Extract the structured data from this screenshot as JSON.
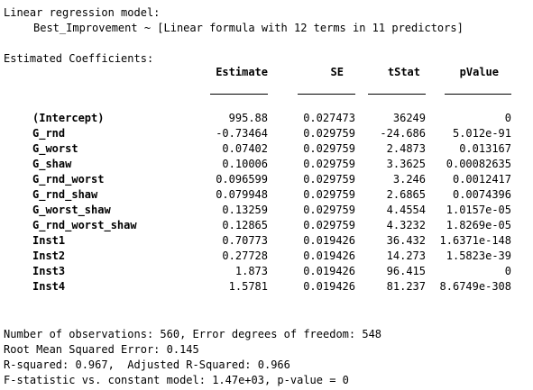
{
  "header": {
    "model_line": "Linear regression model:",
    "formula_line": "Best_Improvement ~ [Linear formula with 12 terms in 11 predictors]"
  },
  "coefficients": {
    "title": "Estimated Coefficients:",
    "columns": [
      "Estimate",
      "SE",
      "tStat",
      "pValue"
    ],
    "rows": [
      {
        "name": "(Intercept)",
        "estimate": "995.88",
        "se": "0.027473",
        "tstat": "36249",
        "pvalue": "0"
      },
      {
        "name": "G_rnd",
        "estimate": "-0.73464",
        "se": "0.029759",
        "tstat": "-24.686",
        "pvalue": "5.012e-91"
      },
      {
        "name": "G_worst",
        "estimate": "0.07402",
        "se": "0.029759",
        "tstat": "2.4873",
        "pvalue": "0.013167"
      },
      {
        "name": "G_shaw",
        "estimate": "0.10006",
        "se": "0.029759",
        "tstat": "3.3625",
        "pvalue": "0.00082635"
      },
      {
        "name": "G_rnd_worst",
        "estimate": "0.096599",
        "se": "0.029759",
        "tstat": "3.246",
        "pvalue": "0.0012417"
      },
      {
        "name": "G_rnd_shaw",
        "estimate": "0.079948",
        "se": "0.029759",
        "tstat": "2.6865",
        "pvalue": "0.0074396"
      },
      {
        "name": "G_worst_shaw",
        "estimate": "0.13259",
        "se": "0.029759",
        "tstat": "4.4554",
        "pvalue": "1.0157e-05"
      },
      {
        "name": "G_rnd_worst_shaw",
        "estimate": "0.12865",
        "se": "0.029759",
        "tstat": "4.3232",
        "pvalue": "1.8269e-05"
      },
      {
        "name": "Inst1",
        "estimate": "0.70773",
        "se": "0.019426",
        "tstat": "36.432",
        "pvalue": "1.6371e-148"
      },
      {
        "name": "Inst2",
        "estimate": "0.27728",
        "se": "0.019426",
        "tstat": "14.273",
        "pvalue": "1.5823e-39"
      },
      {
        "name": "Inst3",
        "estimate": "1.873",
        "se": "0.019426",
        "tstat": "96.415",
        "pvalue": "0"
      },
      {
        "name": "Inst4",
        "estimate": "1.5781",
        "se": "0.019426",
        "tstat": "81.237",
        "pvalue": "8.6749e-308"
      }
    ]
  },
  "summary": {
    "observations_line": "Number of observations: 560, Error degrees of freedom: 548",
    "rmse_line": "Root Mean Squared Error: 0.145",
    "rsquared_line": "R-squared: 0.967,  Adjusted R-Squared: 0.966",
    "fstat_line": "F-statistic vs. constant model: 1.47e+03, p-value = 0"
  }
}
